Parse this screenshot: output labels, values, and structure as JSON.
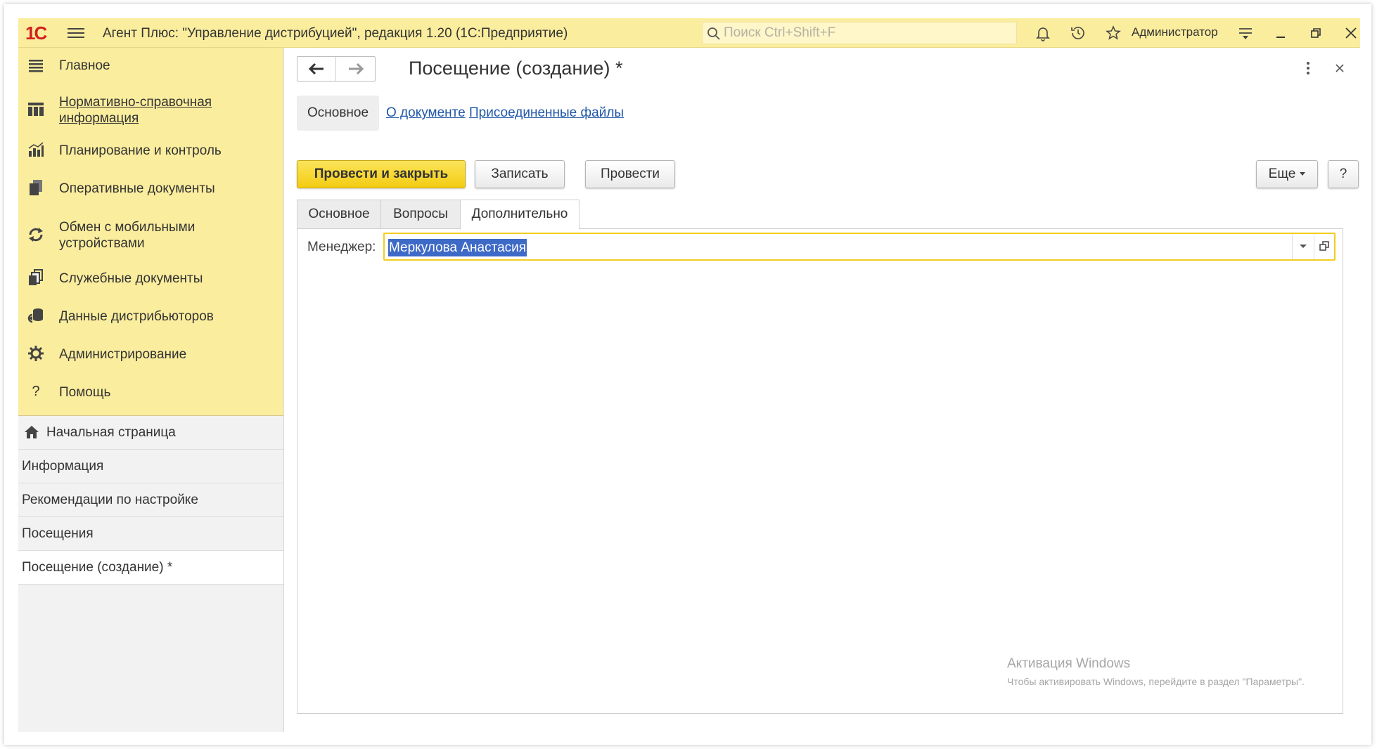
{
  "titlebar": {
    "logo": "1С",
    "title": "Агент Плюс: \"Управление дистрибуцией\", редакция 1.20  (1С:Предприятие)",
    "search_placeholder": "Поиск Ctrl+Shift+F",
    "user": "Администратор"
  },
  "sidebar": {
    "sections": [
      {
        "label": "Главное",
        "icon": "list-icon"
      },
      {
        "label": "Нормативно-справочная информация",
        "icon": "catalog-icon"
      },
      {
        "label": "Планирование и контроль",
        "icon": "chart-icon"
      },
      {
        "label": "Оперативные документы",
        "icon": "documents-icon"
      },
      {
        "label": "Обмен с мобильными устройствами",
        "icon": "sync-icon"
      },
      {
        "label": "Служебные документы",
        "icon": "service-documents-icon"
      },
      {
        "label": "Данные дистрибьюторов",
        "icon": "database-icon"
      },
      {
        "label": "Администрирование",
        "icon": "gear-icon"
      },
      {
        "label": "Помощь",
        "icon": "help-icon"
      }
    ],
    "open_windows": [
      {
        "label": "Начальная страница",
        "icon": "home-icon"
      },
      {
        "label": "Информация"
      },
      {
        "label": "Рекомендации по настройке"
      },
      {
        "label": "Посещения"
      },
      {
        "label": "Посещение (создание) *"
      }
    ]
  },
  "form": {
    "title": "Посещение (создание) *",
    "panel_tabs": [
      "Основное",
      "О документе",
      "Присоединенные файлы"
    ],
    "buttons": {
      "post_close": "Провести и закрыть",
      "save": "Записать",
      "post": "Провести",
      "more": "Еще",
      "help": "?"
    },
    "tabs": [
      "Основное",
      "Вопросы",
      "Дополнительно"
    ],
    "active_tab": "Дополнительно",
    "manager_label": "Менеджер:",
    "manager_value": "Меркулова Анастасия"
  },
  "watermark": {
    "line1": "Активация Windows",
    "line2": "Чтобы активировать Windows, перейдите в раздел \"Параметры\"."
  },
  "colors": {
    "header_bg": "#fbed9e",
    "primary_button": "#f3cc12",
    "link": "#2057a8",
    "logo": "#d3201f",
    "selection": "#3d69c7"
  }
}
